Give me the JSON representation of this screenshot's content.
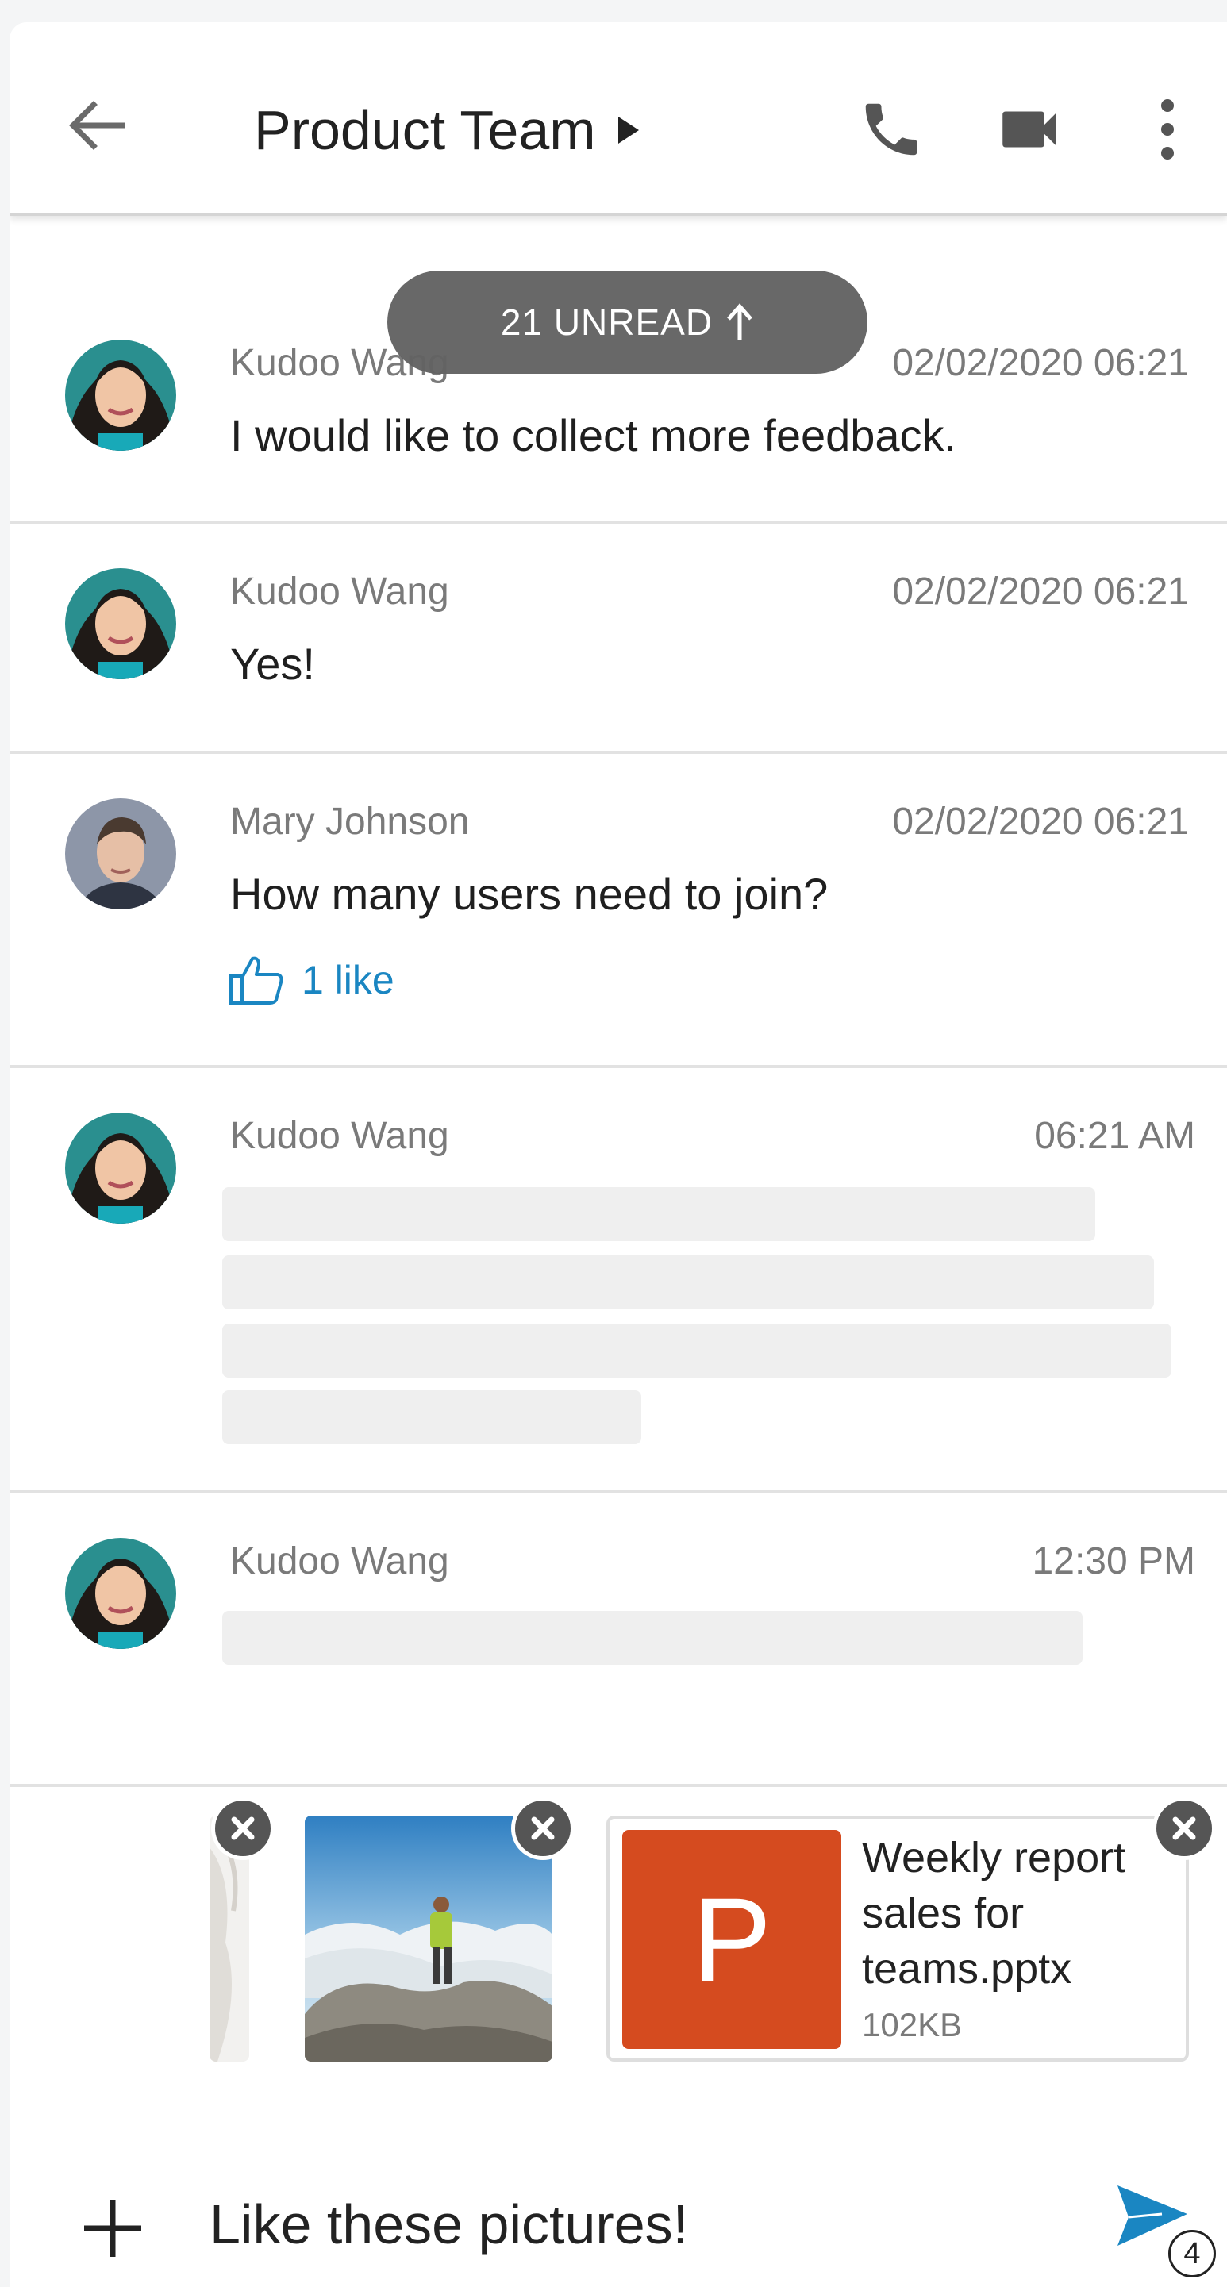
{
  "header": {
    "title": "Product Team"
  },
  "unread": {
    "label": "21 UNREAD"
  },
  "messages": [
    {
      "sender": "Kudoo Wang",
      "time": "02/02/2020 06:21",
      "text": "I would like to collect more feedback."
    },
    {
      "sender": "Kudoo Wang",
      "time": "02/02/2020 06:21",
      "text": "Yes!"
    },
    {
      "sender": "Mary Johnson",
      "time": "02/02/2020 06:21",
      "text": "How many users need to join?",
      "likes": "1 like"
    },
    {
      "sender": "Kudoo Wang",
      "time": "06:21 AM"
    },
    {
      "sender": "Kudoo Wang",
      "time": "12:30 PM"
    }
  ],
  "attachments": {
    "file": {
      "icon_letter": "P",
      "name": "Weekly report sales for teams.pptx",
      "size": "102KB"
    }
  },
  "composer": {
    "value": "Like these pictures!",
    "send_count": "4"
  },
  "colors": {
    "accent": "#1a86c2",
    "pptx": "#d54b1f",
    "unread_pill": "#626262"
  },
  "icons": {
    "back": "arrow-left-icon",
    "title_caret": "caret-right-icon",
    "call": "phone-icon",
    "video": "video-camera-icon",
    "more": "more-vertical-icon",
    "unread_arrow": "arrow-up-icon",
    "like": "thumbs-up-icon",
    "remove": "close-circle-icon",
    "add": "plus-icon",
    "send": "send-icon"
  }
}
